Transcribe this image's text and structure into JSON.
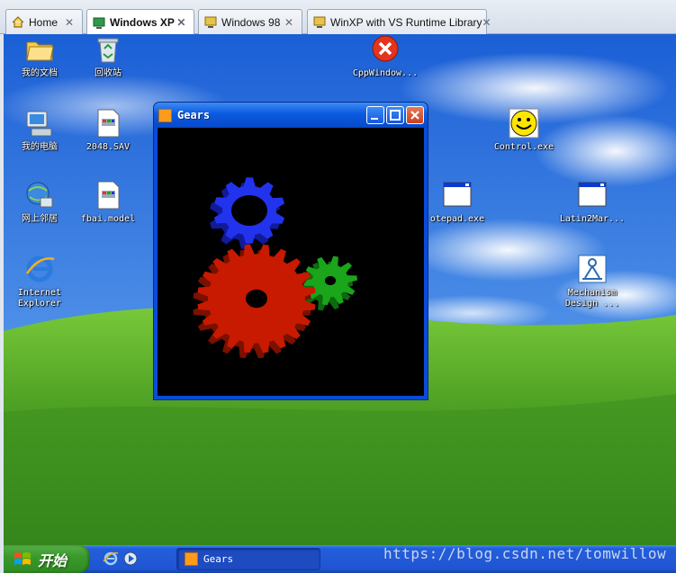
{
  "tabs": [
    {
      "label": "Home",
      "active": false,
      "icon": "home-icon"
    },
    {
      "label": "Windows XP",
      "active": true,
      "icon": "vm-icon"
    },
    {
      "label": "Windows 98",
      "active": false,
      "icon": "vm-icon"
    },
    {
      "label": "WinXP with VS Runtime Library",
      "active": false,
      "icon": "vm-icon"
    }
  ],
  "desktop_icons": {
    "my_documents": "我的文档",
    "recycle_bin": "回收站",
    "cppwindow": "CppWindow...",
    "my_computer": "我的电脑",
    "file_2048": "2048.SAV",
    "control_exe": "Control.exe",
    "network": "网上邻居",
    "fbai_model": "fbai.model",
    "notepad": "otepad.exe",
    "latin2mar": "Latin2Mar...",
    "ie": "Internet\nExplorer",
    "mechanism": "Mechanism\nDesign ..."
  },
  "gears_window": {
    "title": "Gears",
    "colors": {
      "red_gear": "#c81a00",
      "green_gear": "#1aa51a",
      "blue_gear": "#2233ee"
    }
  },
  "taskbar": {
    "start_label": "开始",
    "task_gears": "Gears"
  },
  "watermark": "https://blog.csdn.net/tomwillow"
}
